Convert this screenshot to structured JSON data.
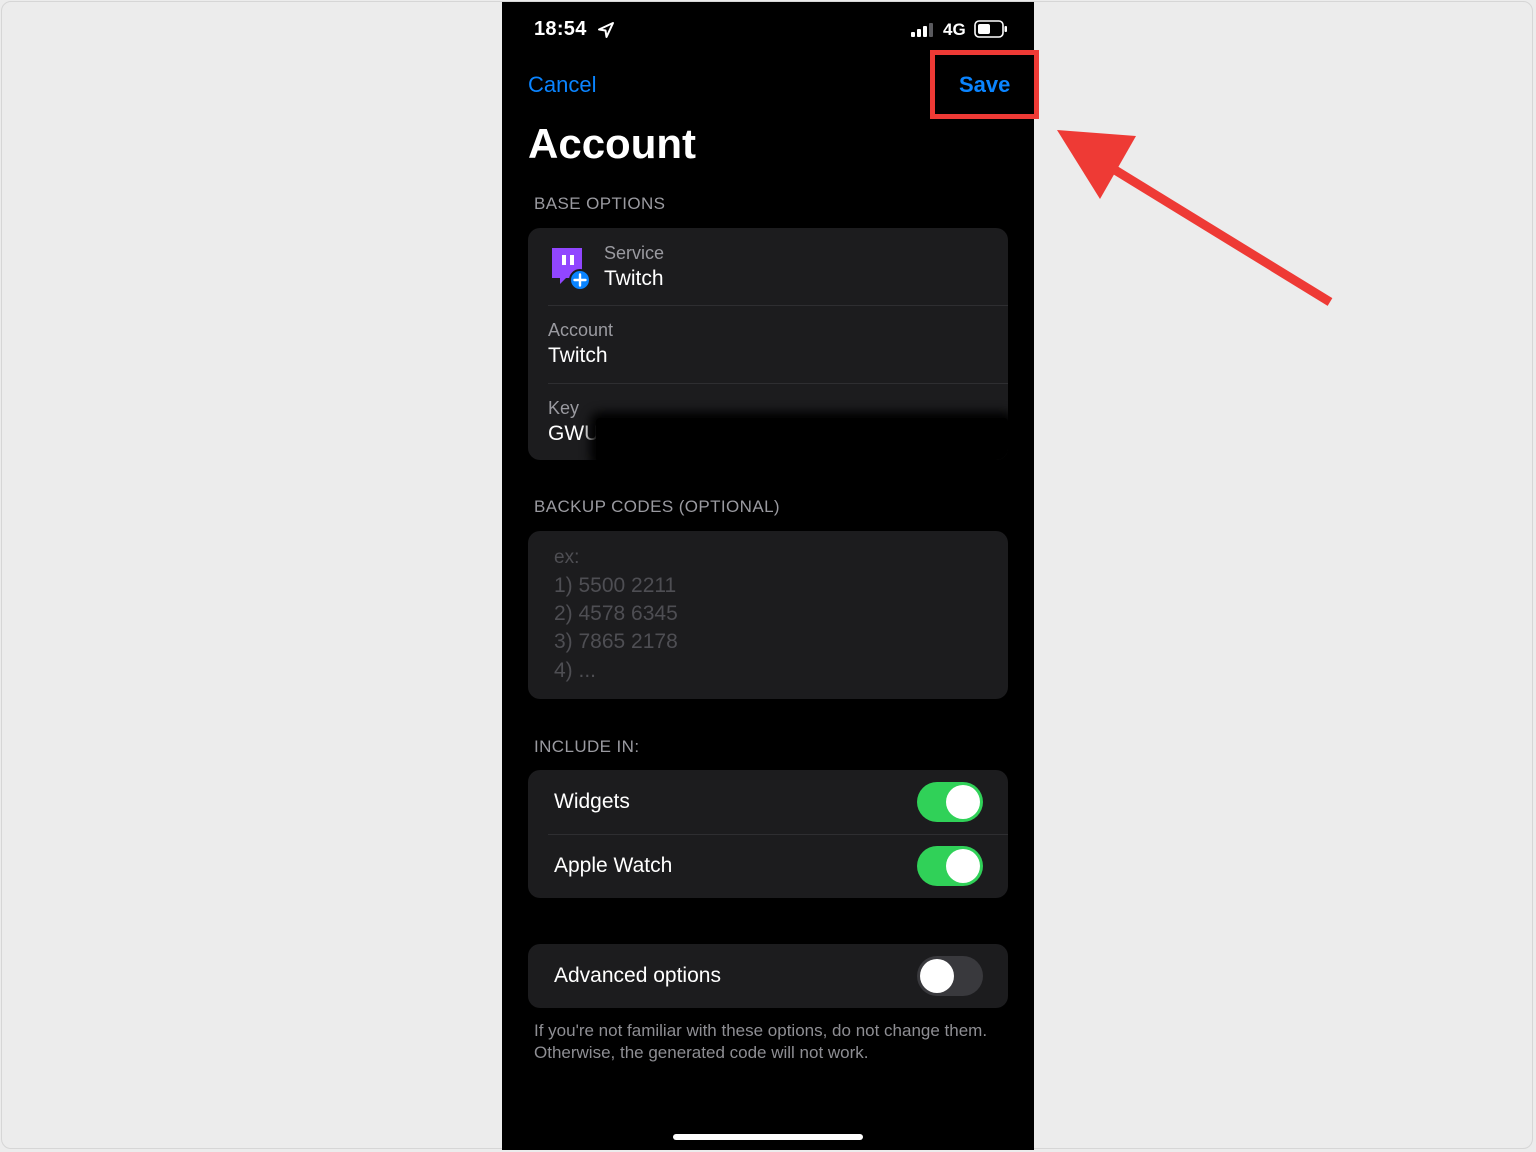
{
  "status_bar": {
    "time": "18:54",
    "network": "4G",
    "icons": [
      "location-arrow-icon",
      "signal-bars-icon",
      "battery-icon"
    ]
  },
  "nav": {
    "cancel_label": "Cancel",
    "save_label": "Save",
    "title": "Account"
  },
  "base_options": {
    "header": "BASE OPTIONS",
    "service": {
      "label": "Service",
      "value": "Twitch",
      "icon": "twitch-icon"
    },
    "account": {
      "label": "Account",
      "value": "Twitch"
    },
    "key": {
      "label": "Key",
      "value": "GWU"
    }
  },
  "backup_codes": {
    "header": "BACKUP CODES (OPTIONAL)",
    "placeholder_lines": [
      "ex:",
      "1) 5500 2211",
      "2) 4578 6345",
      "3) 7865 2178",
      "4) ..."
    ]
  },
  "include_in": {
    "header": "INCLUDE IN:",
    "items": [
      {
        "label": "Widgets",
        "enabled": true
      },
      {
        "label": "Apple Watch",
        "enabled": true
      }
    ]
  },
  "advanced": {
    "label": "Advanced options",
    "enabled": false,
    "note": "If you're not familiar with these options, do not change them. Otherwise, the generated code will not work."
  },
  "colors": {
    "accent": "#0a84ff",
    "toggle_on": "#30d158",
    "annotation": "#ee3a35",
    "twitch_purple": "#9146ff"
  }
}
